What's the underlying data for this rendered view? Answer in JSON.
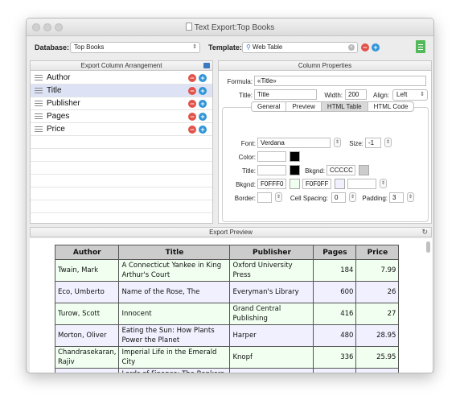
{
  "window": {
    "title": "Text Export:Top Books"
  },
  "toolbar": {
    "database_label": "Database:",
    "database_value": "Top Books",
    "template_label": "Template:",
    "template_value": "Web Table"
  },
  "columns_panel": {
    "title": "Export Column Arrangement",
    "columns": [
      {
        "label": "Author",
        "selected": false
      },
      {
        "label": "Title",
        "selected": true
      },
      {
        "label": "Publisher",
        "selected": false
      },
      {
        "label": "Pages",
        "selected": false
      },
      {
        "label": "Price",
        "selected": false
      }
    ]
  },
  "properties_panel": {
    "title": "Column Properties",
    "formula_label": "Formula:",
    "formula_value": "«Title»",
    "title_label": "Title:",
    "title_value": "Title",
    "width_label": "Width:",
    "width_value": "200",
    "align_label": "Align:",
    "align_value": "Left",
    "tabs": [
      "General",
      "Preview",
      "HTML Table",
      "HTML Code"
    ],
    "active_tab": "HTML Table",
    "font_label": "Font:",
    "font_value": "Verdana",
    "size_label": "Size:",
    "size_value": "-1",
    "color_label": "Color:",
    "title_row_label": "Title:",
    "bkgnd_label": "Bkgnd:",
    "bkgnd_value": "CCCCC",
    "bkgnd2_label": "Bkgnd:",
    "bkgnd2_value1": "F0FFF0",
    "bkgnd2_value2": "F0F0FF",
    "border_label": "Border:",
    "cell_spacing_label": "Cell Spacing:",
    "cell_spacing_value": "0",
    "padding_label": "Padding:",
    "padding_value": "3"
  },
  "colors": {
    "swatch_black": "#000000",
    "swatch_gray": "#cccccc",
    "swatch_green": "#f0fff0",
    "swatch_lilac": "#f0f0ff"
  },
  "preview": {
    "title": "Export Preview",
    "headers": [
      "Author",
      "Title",
      "Publisher",
      "Pages",
      "Price"
    ],
    "rows": [
      [
        "Twain, Mark",
        "A Connecticut Yankee in King Arthur's Court",
        "Oxford University Press",
        "184",
        "7.99"
      ],
      [
        "Eco, Umberto",
        "Name of the Rose, The",
        "Everyman's Library",
        "600",
        "26"
      ],
      [
        "Turow, Scott",
        "Innocent",
        "Grand Central Publishing",
        "416",
        "27"
      ],
      [
        "Morton, Oliver",
        "Eating the Sun: How Plants Power the Planet",
        "Harper",
        "480",
        "28.95"
      ],
      [
        "Chandrasekaran, Rajiv",
        "Imperial Life in the Emerald City",
        "Knopf",
        "336",
        "25.95"
      ],
      [
        "",
        "Lords of Finance: The Bankers",
        "",
        "",
        ""
      ]
    ]
  }
}
